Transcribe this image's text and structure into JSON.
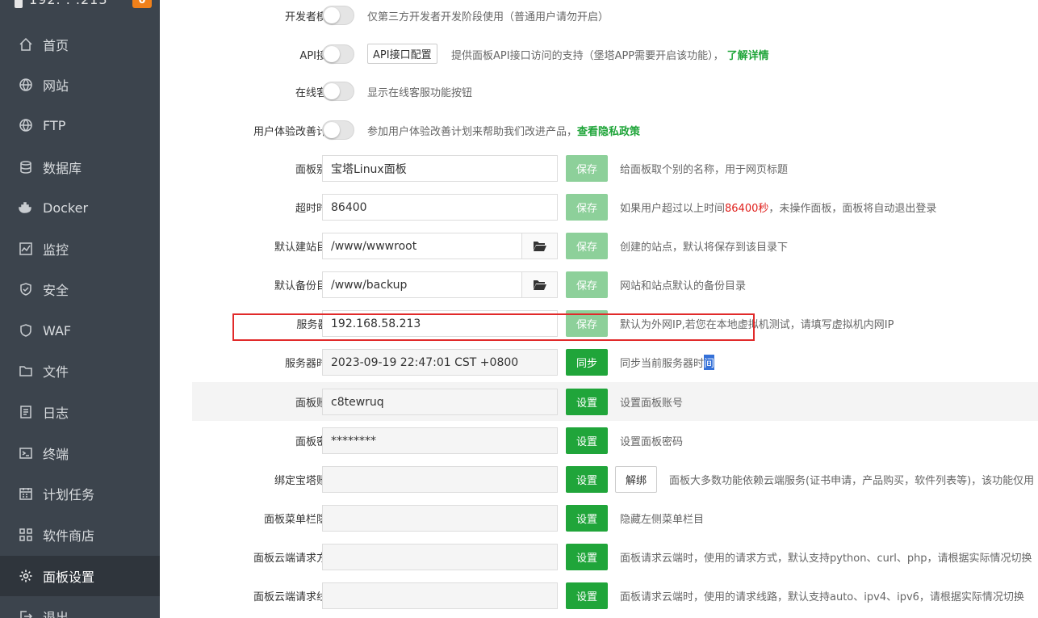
{
  "sidebar": {
    "server_ip": "192.   .   .213",
    "badge": "0",
    "items": [
      {
        "label": "首页",
        "icon": "home-icon"
      },
      {
        "label": "网站",
        "icon": "globe-icon"
      },
      {
        "label": "FTP",
        "icon": "globe-icon"
      },
      {
        "label": "数据库",
        "icon": "database-icon"
      },
      {
        "label": "Docker",
        "icon": "docker-icon"
      },
      {
        "label": "监控",
        "icon": "monitor-icon"
      },
      {
        "label": "安全",
        "icon": "shield-icon"
      },
      {
        "label": "WAF",
        "icon": "waf-shield-icon"
      },
      {
        "label": "文件",
        "icon": "folder-icon"
      },
      {
        "label": "日志",
        "icon": "log-icon"
      },
      {
        "label": "终端",
        "icon": "terminal-icon"
      },
      {
        "label": "计划任务",
        "icon": "calendar-icon"
      },
      {
        "label": "软件商店",
        "icon": "apps-icon"
      },
      {
        "label": "面板设置",
        "icon": "gear-icon"
      },
      {
        "label": "退出",
        "icon": "logout-icon"
      }
    ]
  },
  "settings": {
    "dev_mode": {
      "label": "开发者模式",
      "desc": "仅第三方开发者开发阶段使用（普通用户请勿开启）"
    },
    "api": {
      "label": "API接口",
      "button": "API接口配置",
      "desc": "提供面板API接口访问的支持（堡塔APP需要开启该功能），",
      "link": "了解详情"
    },
    "online_service": {
      "label": "在线客服",
      "desc": "显示在线客服功能按钮"
    },
    "ux_plan": {
      "label": "用户体验改善计划",
      "desc": "参加用户体验改善计划来帮助我们改进产品，",
      "link": "查看隐私政策"
    },
    "panel_alias": {
      "label": "面板别名",
      "value": "宝塔Linux面板",
      "button": "保存",
      "desc": "给面板取个别的名称，用于网页标题"
    },
    "timeout": {
      "label": "超时时间",
      "value": "86400",
      "button": "保存",
      "desc_pre": "如果用户超过以上时间 ",
      "desc_red": "86400秒",
      "desc_post": "，未操作面板，面板将自动退出登录"
    },
    "site_dir": {
      "label": "默认建站目录",
      "value": "/www/wwwroot",
      "button": "保存",
      "desc": "创建的站点，默认将保存到该目录下"
    },
    "backup_dir": {
      "label": "默认备份目录",
      "value": "/www/backup",
      "button": "保存",
      "desc": "网站和站点默认的备份目录"
    },
    "server_ip": {
      "label": "服务器IP",
      "value": "192.168.58.213",
      "button": "保存",
      "desc": "默认为外网IP,若您在本地虚拟机测试，请填写虚拟机内网IP"
    },
    "server_time": {
      "label": "服务器时间",
      "value": "2023-09-19 22:47:01 CST +0800",
      "button": "同步",
      "desc_pre": "同步当前服务器时",
      "desc_sel": "间"
    },
    "panel_account": {
      "label": "面板账号",
      "value": "c8tewruq",
      "button": "设置",
      "desc": "设置面板账号"
    },
    "panel_password": {
      "label": "面板密码",
      "value": "********",
      "button": "设置",
      "desc": "设置面板密码"
    },
    "bind_account": {
      "label": "绑定宝塔账号",
      "value": "",
      "button": "设置",
      "button2": "解绑",
      "desc": "面板大多数功能依赖云端服务(证书申请，产品购买，软件列表等)，该功能仅用"
    },
    "menu_hide": {
      "label": "面板菜单栏隐藏",
      "value": "",
      "button": "设置",
      "desc": "隐藏左侧菜单栏目"
    },
    "cloud_method": {
      "label": "面板云端请求方式",
      "value": "",
      "button": "设置",
      "desc": "面板请求云端时，使用的请求方式，默认支持python、curl、php，请根据实际情况切换"
    },
    "cloud_route": {
      "label": "面板云端请求线路",
      "value": "",
      "button": "设置",
      "desc": "面板请求云端时，使用的请求线路，默认支持auto、ipv4、ipv6，请根据实际情况切换"
    }
  }
}
